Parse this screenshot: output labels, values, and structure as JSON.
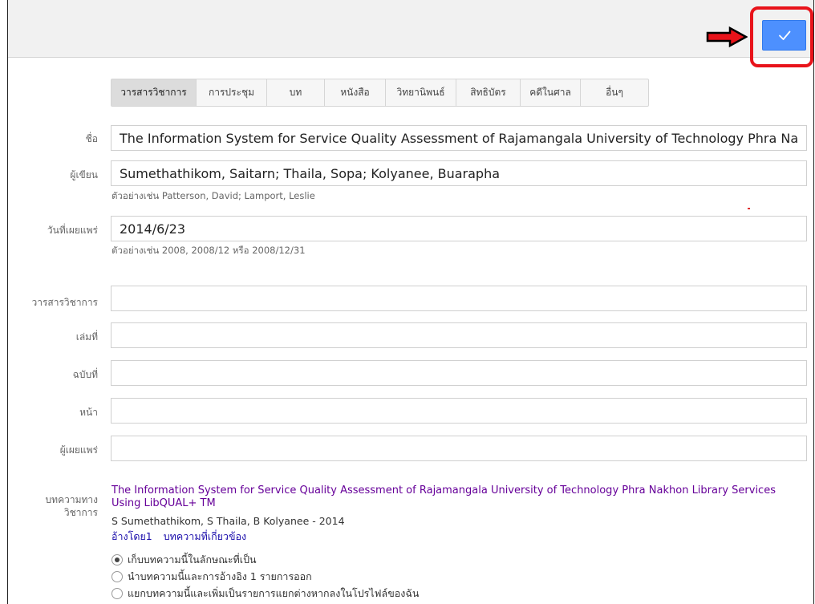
{
  "tabs": [
    {
      "label": "วารสารวิชาการ",
      "active": true
    },
    {
      "label": "การประชุม",
      "active": false
    },
    {
      "label": "บท",
      "active": false
    },
    {
      "label": "หนังสือ",
      "active": false
    },
    {
      "label": "วิทยานิพนธ์",
      "active": false
    },
    {
      "label": "สิทธิบัตร",
      "active": false
    },
    {
      "label": "คดีในศาล",
      "active": false
    },
    {
      "label": "อื่นๆ",
      "active": false
    }
  ],
  "form": {
    "title_label": "ชื่อ",
    "title_value": "The Information System for Service Quality Assessment of Rajamangala University of Technology Phra Na",
    "authors_label": "ผู้เขียน",
    "authors_value": "Sumethathikom, Saitarn; Thaila, Sopa; Kolyanee, Buarapha",
    "authors_hint": "ตัวอย่างเช่น Patterson, David; Lamport, Leslie",
    "date_label": "วันที่เผยแพร่",
    "date_value": "2014/6/23",
    "date_hint": "ตัวอย่างเช่น 2008, 2008/12 หรือ 2008/12/31",
    "journal_label": "วารสารวิชาการ",
    "journal_value": "",
    "volume_label": "เล่มที่",
    "volume_value": "",
    "issue_label": "ฉบับที่",
    "issue_value": "",
    "pages_label": "หน้า",
    "pages_value": "",
    "publisher_label": "ผู้เผยแพร่",
    "publisher_value": ""
  },
  "article": {
    "label_line1": "บทความทาง",
    "label_line2": "วิชาการ",
    "title": "The Information System for Service Quality Assessment of Rajamangala University of Technology Phra Nakhon Library Services Using LibQUAL+ TM",
    "meta": "S Sumethathikom, S Thaila, B Kolyanee - 2014",
    "cited_by": "อ้างโดย1",
    "related": "บทความที่เกี่ยวข้อง"
  },
  "options": [
    {
      "label": "เก็บบทความนี้ในลักษณะที่เป็น",
      "checked": true
    },
    {
      "label": "นำบทความนี้และการอ้างอิง 1 รายการออก",
      "checked": false
    },
    {
      "label": "แยกบทความนี้และเพิ่มเป็นรายการแยกต่างหากลงในโปรไฟล์ของฉัน",
      "checked": false
    }
  ],
  "icons": {
    "save": "checkmark-icon",
    "pointer": "arrow-right-icon"
  },
  "colors": {
    "accent": "#4d90fe",
    "highlight": "#e8131a",
    "link": "#1a0dab",
    "visited": "#660099"
  }
}
